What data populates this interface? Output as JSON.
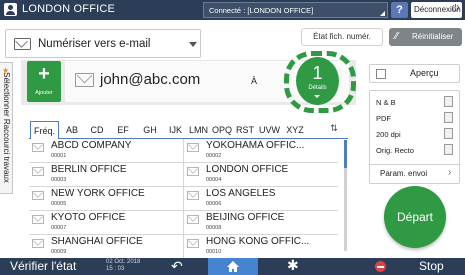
{
  "topbar": {
    "title": "LONDON OFFICE",
    "connection": "Connecté : [LONDON OFFICE]",
    "help": "?",
    "logout": "Déconnexion"
  },
  "mode": {
    "selected": "Numériser vers e-mail"
  },
  "buttons": {
    "status": "État fich. numér.",
    "reset": "Réinitialiser",
    "preview": "Aperçu",
    "send_settings": "Param. envoi",
    "start": "Départ"
  },
  "side_tab": {
    "label": "Sélectionner Raccourci travaux"
  },
  "destination": {
    "add_label": "Ajouter",
    "address": "john@abc.com",
    "to_label": "À",
    "count": "1",
    "details_label": "Détails"
  },
  "tabs": [
    "Fréq.",
    "AB",
    "CD",
    "EF",
    "GH",
    "IJK",
    "LMN",
    "OPQ",
    "RST",
    "UVW",
    "XYZ"
  ],
  "selected_tab": "Fréq.",
  "addresses": [
    {
      "name": "ABCD COMPANY",
      "number": "00001"
    },
    {
      "name": "YOKOHAMA OFFIC...",
      "number": "00002"
    },
    {
      "name": "BERLIN OFFICE",
      "number": "00003"
    },
    {
      "name": "LONDON OFFICE",
      "number": "00004"
    },
    {
      "name": "NEW YORK OFFICE",
      "number": "00005"
    },
    {
      "name": "LOS ANGELES",
      "number": "00006"
    },
    {
      "name": "KYOTO OFFICE",
      "number": "00007"
    },
    {
      "name": "BEIJING OFFICE",
      "number": "00008"
    },
    {
      "name": "SHANGHAI  OFFICE",
      "number": "00009"
    },
    {
      "name": "HONG KONG OFFIC...",
      "number": "00010"
    }
  ],
  "settings": {
    "color": "N & B",
    "format": "PDF",
    "resolution": "200 dpi",
    "sides": "Orig. Recto"
  },
  "bottombar": {
    "check_status": "Vérifier l'état",
    "date": "02 Oct. 2018",
    "time": "15 : 03",
    "stop": "Stop"
  },
  "colors": {
    "bar": "#2c3e57",
    "green": "#2f9a43",
    "tab_blue": "#4d7fc0",
    "home_blue": "#4683d1",
    "stop_red": "#e24040"
  },
  "icons": [
    "user-icon",
    "mail-icon",
    "reset-icon",
    "star-icon",
    "plus-icon",
    "back-icon",
    "home-icon",
    "gear-icon",
    "stop-icon",
    "sort-icon"
  ]
}
